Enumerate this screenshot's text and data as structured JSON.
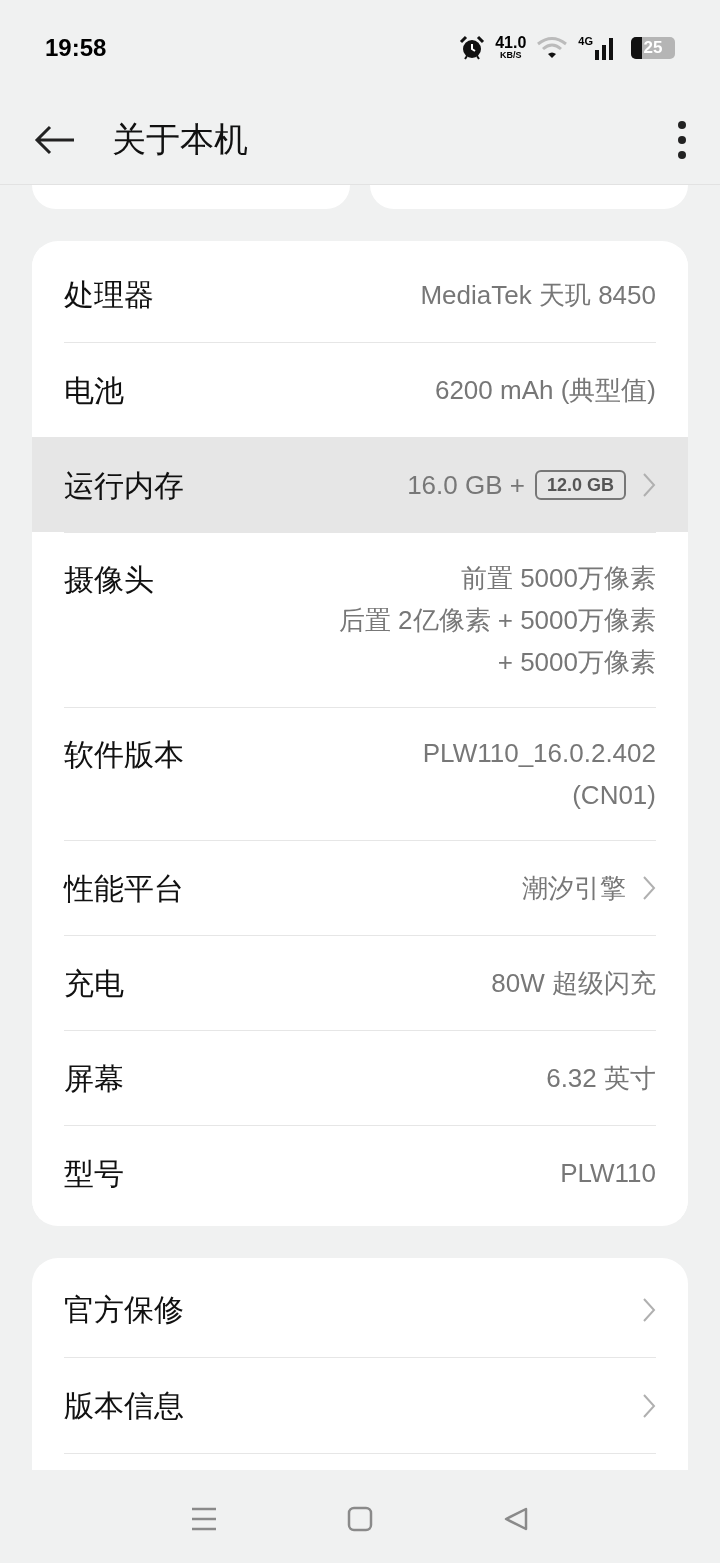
{
  "status_bar": {
    "time": "19:58",
    "speed": "41.0",
    "speed_unit": "KB/S",
    "network": "4G",
    "battery": "25"
  },
  "header": {
    "title": "关于本机"
  },
  "specs": [
    {
      "label": "处理器",
      "value": [
        "MediaTek 天玑 8450"
      ],
      "highlighted": false,
      "chevron": false
    },
    {
      "label": "电池",
      "value": [
        "6200 mAh (典型值)"
      ],
      "highlighted": false,
      "chevron": false
    },
    {
      "label": "运行内存",
      "value": [
        "16.0 GB +"
      ],
      "badge": "12.0 GB",
      "highlighted": true,
      "chevron": true
    },
    {
      "label": "摄像头",
      "value": [
        "前置 5000万像素",
        "后置 2亿像素 + 5000万像素",
        "+ 5000万像素"
      ],
      "highlighted": false,
      "chevron": false
    },
    {
      "label": "软件版本",
      "value": [
        "PLW110_16.0.2.402",
        "(CN01)"
      ],
      "highlighted": false,
      "chevron": false
    },
    {
      "label": "性能平台",
      "value": [
        "潮汐引擎"
      ],
      "highlighted": false,
      "chevron": true
    },
    {
      "label": "充电",
      "value": [
        "80W 超级闪充"
      ],
      "highlighted": false,
      "chevron": false
    },
    {
      "label": "屏幕",
      "value": [
        "6.32 英寸"
      ],
      "highlighted": false,
      "chevron": false
    },
    {
      "label": "型号",
      "value": [
        "PLW110"
      ],
      "highlighted": false,
      "chevron": false
    }
  ],
  "links": [
    {
      "label": "官方保修"
    },
    {
      "label": "版本信息"
    }
  ]
}
